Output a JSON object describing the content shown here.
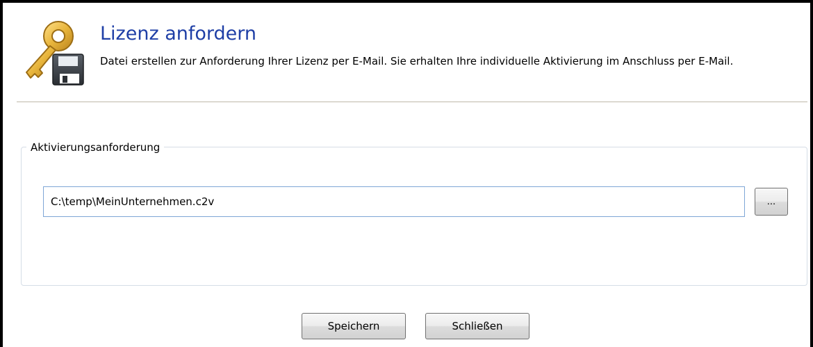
{
  "header": {
    "title": "Lizenz anfordern",
    "description": "Datei erstellen zur Anforderung Ihrer Lizenz per E-Mail. Sie erhalten Ihre individuelle Aktivierung im Anschluss per E-Mail.",
    "icon": "key-with-floppy-disk-icon"
  },
  "activation_group": {
    "label": "Aktivierungsanforderung",
    "file_path": "C:\\temp\\MeinUnternehmen.c2v",
    "browse_label": "..."
  },
  "footer": {
    "save_label": "Speichern",
    "close_label": "Schließen"
  },
  "colors": {
    "title": "#1f3fa6",
    "input_border": "#7ea6d6",
    "group_border": "#d5dde6",
    "key_gold": "#e8b53c"
  }
}
